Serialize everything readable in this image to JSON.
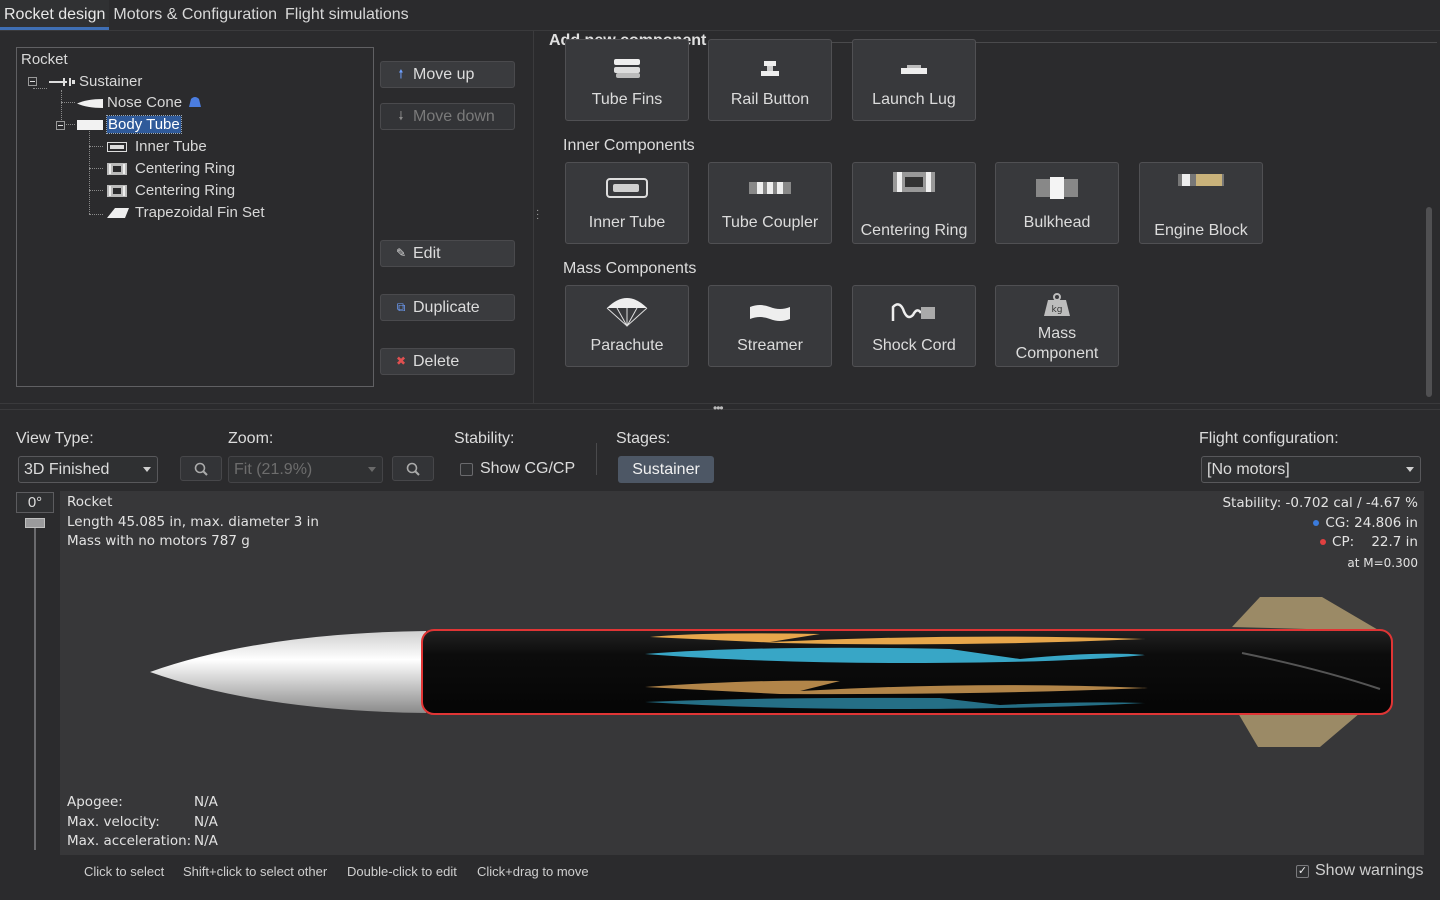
{
  "tabs": [
    "Rocket design",
    "Motors & Configuration",
    "Flight simulations"
  ],
  "tree": {
    "root": "Rocket",
    "sustainer": "Sustainer",
    "nose_cone": "Nose Cone",
    "body_tube": "Body Tube",
    "inner_tube": "Inner Tube",
    "centering_ring_1": "Centering Ring",
    "centering_ring_2": "Centering Ring",
    "fin_set": "Trapezoidal Fin Set"
  },
  "actions": {
    "move_up": "Move up",
    "move_down": "Move down",
    "edit": "Edit",
    "duplicate": "Duplicate",
    "delete": "Delete"
  },
  "palette": {
    "title": "Add new component",
    "top_row": [
      "Tube Fins",
      "Rail Button",
      "Launch Lug"
    ],
    "inner_title": "Inner Components",
    "inner": [
      "Inner Tube",
      "Tube Coupler",
      "Centering Ring",
      "Bulkhead",
      "Engine Block"
    ],
    "mass_title": "Mass Components",
    "mass": [
      "Parachute",
      "Streamer",
      "Shock Cord",
      "Mass Component"
    ],
    "mass_icon_text": "kg"
  },
  "view": {
    "view_type_label": "View Type:",
    "view_type_value": "3D Finished",
    "zoom_label": "Zoom:",
    "zoom_value": "Fit (21.9%)",
    "stability_label": "Stability:",
    "show_cgcp": "Show CG/CP",
    "stages_label": "Stages:",
    "stage": "Sustainer",
    "flight_config_label": "Flight configuration:",
    "flight_config_value": "[No motors]",
    "rotation": "0°"
  },
  "figure": {
    "name": "Rocket",
    "length_line": "Length 45.085 in, max. diameter 3 in",
    "mass_line": "Mass with no motors 787 g",
    "stability": "Stability: -0.702 cal / -4.67 %",
    "cg_label": "CG:",
    "cg_value": "24.806 in",
    "cp_label": "CP:",
    "cp_value": "22.7 in",
    "mach": "at M=0.300",
    "apogee_label": "Apogee:",
    "apogee_value": "N/A",
    "maxvel_label": "Max. velocity:",
    "maxvel_value": "N/A",
    "maxacc_label": "Max. acceleration:",
    "maxacc_value": "N/A",
    "colors": {
      "cg": "#3b7bdc",
      "cp": "#e04040",
      "body_outline": "#e03535"
    }
  },
  "status": {
    "hints": [
      "Click to select",
      "Shift+click to select other",
      "Double-click to edit",
      "Click+drag to move"
    ],
    "show_warnings": "Show warnings"
  }
}
